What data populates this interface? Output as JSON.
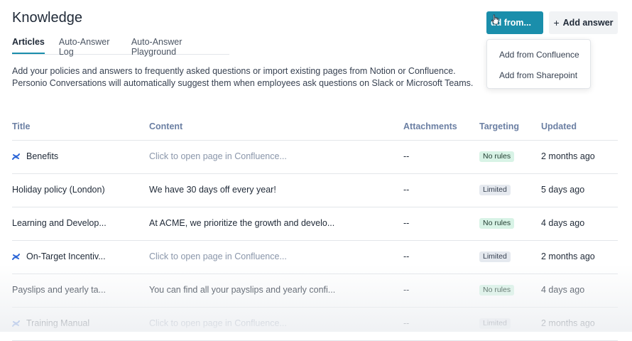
{
  "page": {
    "title": "Knowledge"
  },
  "tabs": [
    {
      "label": "Articles",
      "active": true
    },
    {
      "label": "Auto-Answer Log",
      "active": false
    },
    {
      "label": "Auto-Answer Playground",
      "active": false
    }
  ],
  "description": {
    "line1": "Add your policies and answers to frequently asked questions or import existing pages from Notion or Confluence.",
    "line2": "Personio Conversations will automatically suggest them when employees ask questions on Slack or Microsoft Teams."
  },
  "toolbar": {
    "add_from_label": "dd from...",
    "add_answer_label": "Add answer",
    "accent_color": "#1a8eab"
  },
  "dropdown": {
    "items": [
      {
        "label": "Add from Confluence"
      },
      {
        "label": "Add from Sharepoint"
      }
    ]
  },
  "table": {
    "columns": [
      "Title",
      "Content",
      "Attachments",
      "Targeting",
      "Updated"
    ],
    "rows": [
      {
        "title": "Benefits",
        "source_icon": "confluence-icon",
        "content": "Click to open page in Confluence...",
        "content_muted": true,
        "attachments": "--",
        "targeting": "No rules",
        "updated": "2 months ago"
      },
      {
        "title": "Holiday policy (London)",
        "source_icon": "",
        "content": "We have 30 days off every year!",
        "content_muted": false,
        "attachments": "--",
        "targeting": "Limited",
        "updated": "5 days ago"
      },
      {
        "title": "Learning and Develop...",
        "source_icon": "",
        "content": "At ACME, we prioritize the growth and develo...",
        "content_muted": false,
        "attachments": "--",
        "targeting": "No rules",
        "updated": "4 days ago"
      },
      {
        "title": "On-Target Incentiv...",
        "source_icon": "confluence-icon",
        "content": "Click to open page in Confluence...",
        "content_muted": true,
        "attachments": "--",
        "targeting": "Limited",
        "updated": "2 months ago"
      },
      {
        "title": "Payslips and yearly ta...",
        "source_icon": "",
        "content": "You can find all your payslips and yearly confi...",
        "content_muted": false,
        "attachments": "--",
        "targeting": "No rules",
        "updated": "4 days ago"
      },
      {
        "title": "Training Manual",
        "source_icon": "confluence-icon",
        "content": "Click to open page in Confluence...",
        "content_muted": true,
        "attachments": "--",
        "targeting": "Limited",
        "updated": "2 months ago"
      }
    ]
  }
}
